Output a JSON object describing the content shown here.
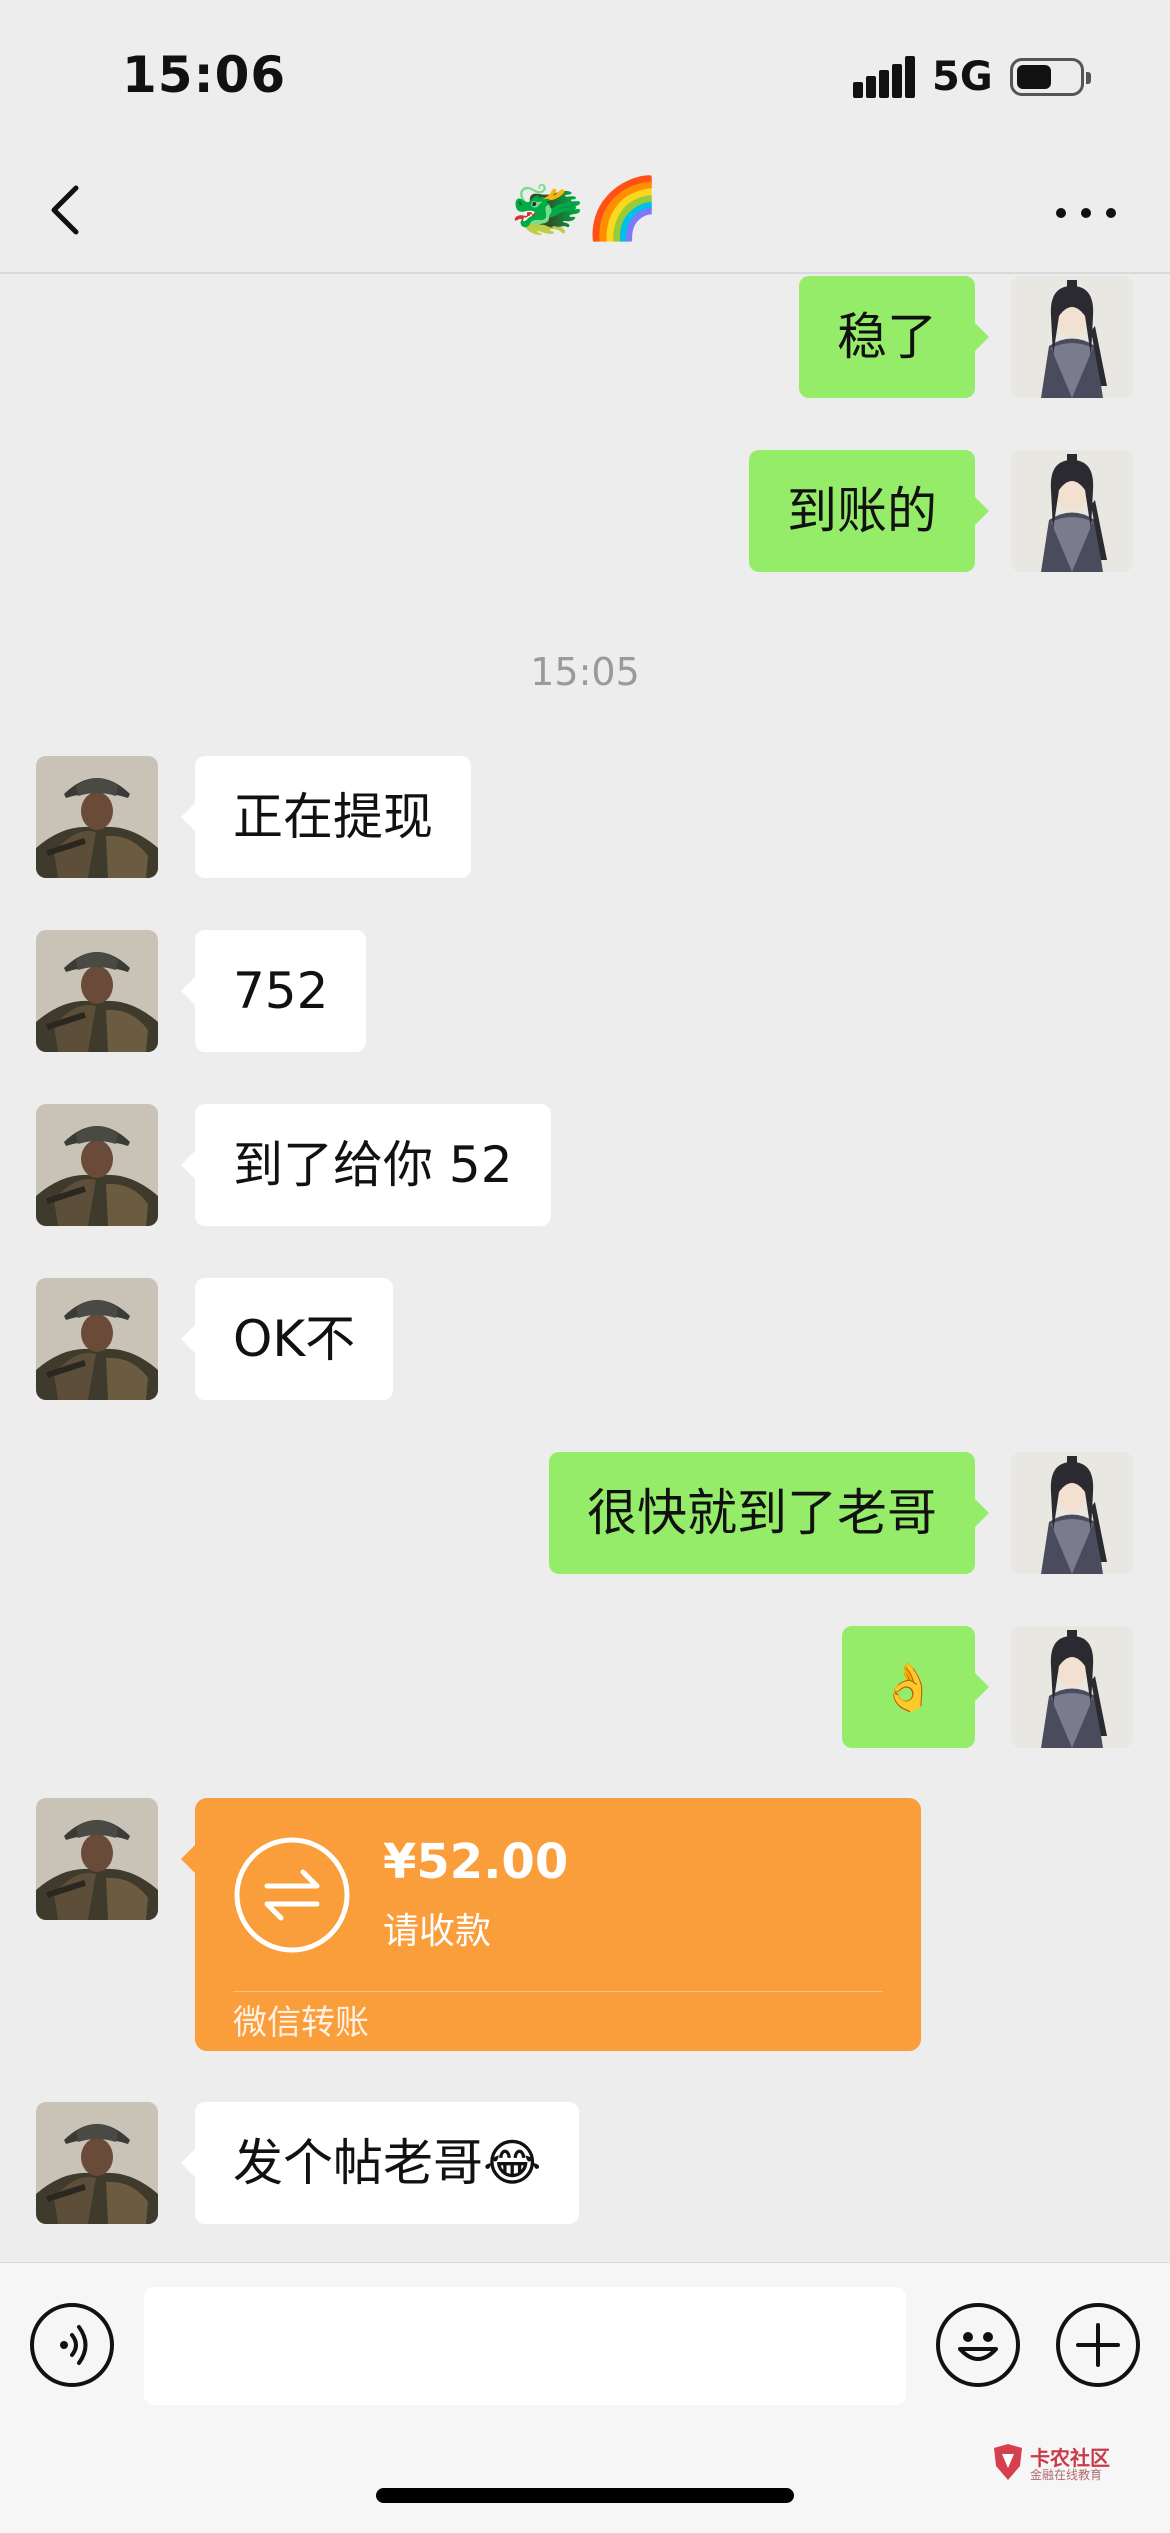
{
  "status_bar": {
    "time": "15:06",
    "network": "5G"
  },
  "nav": {
    "title": "🐲🌈"
  },
  "messages": {
    "m1": {
      "text": "稳了"
    },
    "m2": {
      "text": "到账的"
    },
    "timestamp": "15:05",
    "m3": {
      "text": "正在提现"
    },
    "m4": {
      "text": "752"
    },
    "m5": {
      "text": "到了给你 52"
    },
    "m6": {
      "text": "OK不"
    },
    "m7": {
      "text": "很快就到了老哥"
    },
    "m8": {
      "text": "👌"
    },
    "transfer": {
      "amount": "¥52.00",
      "status": "请收款",
      "label": "微信转账"
    },
    "m9": {
      "text": "发个帖老哥😂"
    }
  },
  "input_bar": {
    "message_value": ""
  },
  "watermark": {
    "title": "卡农社区",
    "subtitle": "金融在线教育"
  },
  "colors": {
    "outgoing_bubble": "#95EC69",
    "incoming_bubble": "#FFFFFF",
    "transfer_card": "#FA9D3B",
    "background": "#EDEDED"
  },
  "icons": {
    "back": "chevron-left-icon",
    "more": "more-dots-icon",
    "voice": "voice-icon",
    "emoji": "emoji-icon",
    "plus": "plus-icon",
    "transfer": "transfer-arrows-icon"
  }
}
